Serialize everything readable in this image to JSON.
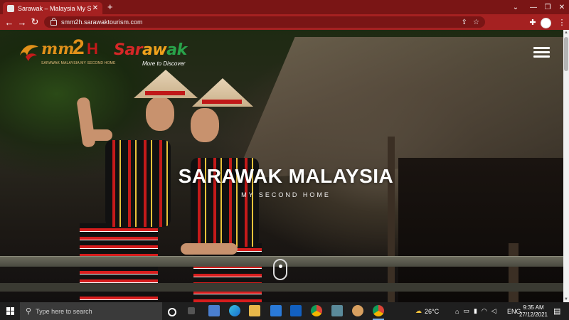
{
  "browser": {
    "tab_title": "Sarawak – Malaysia My Second Home",
    "tab_close_icon": "close-icon",
    "new_tab_label": "+",
    "url": "smm2h.sarawaktourism.com",
    "accent_color": "#a52121",
    "icons": [
      "back-icon",
      "forward-icon",
      "reload-icon",
      "lock-icon",
      "share-icon",
      "star-icon",
      "extensions-icon",
      "profile-avatar",
      "menu-icon"
    ],
    "window_controls": [
      "minimize-icon",
      "restore-icon",
      "close-icon"
    ]
  },
  "hero": {
    "title": "SARAWAK MALAYSIA",
    "subtitle": "MY SECOND HOME",
    "menu_icon": "hamburger-icon",
    "logos": {
      "mm2h_mark": "mm2h",
      "mm2h_tagline": "SARAWAK MALAYSIA MY SECOND HOME",
      "sarawak_name": "Sarawak",
      "sarawak_tagline": "More to Discover"
    }
  },
  "taskbar": {
    "search_placeholder": "Type here to search",
    "weather": "26°C",
    "language": "ENG",
    "time": "9:35 AM",
    "date": "27/12/2021",
    "apps": [
      "task-view-icon",
      "cortana-icon",
      "store-icon",
      "edge-icon",
      "file-explorer-icon",
      "mail-icon",
      "outlook-icon",
      "chrome-icon",
      "app-icon",
      "paint-icon",
      "chrome-active-icon"
    ]
  }
}
